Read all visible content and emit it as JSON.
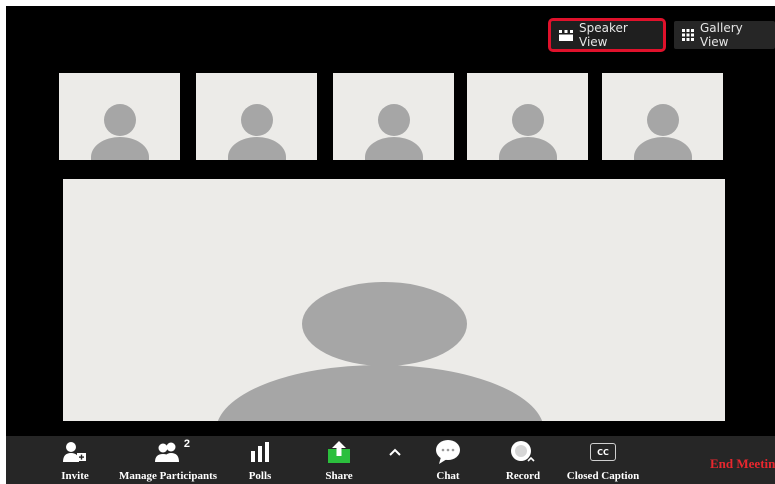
{
  "view_buttons": {
    "speaker_label": "Speaker View",
    "gallery_label": "Gallery View",
    "speaker_icon": "speaker-view-icon",
    "gallery_icon": "gallery-grid-icon"
  },
  "participants": {
    "count": "2"
  },
  "toolbar": {
    "invite_label": "Invite",
    "manage_participants_label": "Manage Participants",
    "polls_label": "Polls",
    "share_label": "Share",
    "chat_label": "Chat",
    "record_label": "Record",
    "closed_caption_label": "Closed Caption",
    "cc_text": "CC",
    "end_meeting_label": "End Meeting"
  },
  "colors": {
    "background": "#000000",
    "toolbar": "#262626",
    "highlight": "#e0112b",
    "share_green": "#2bbf3d",
    "end_meeting_red": "#e8272e",
    "video_tile": "#ecebe8",
    "avatar": "#a6a6a6"
  }
}
